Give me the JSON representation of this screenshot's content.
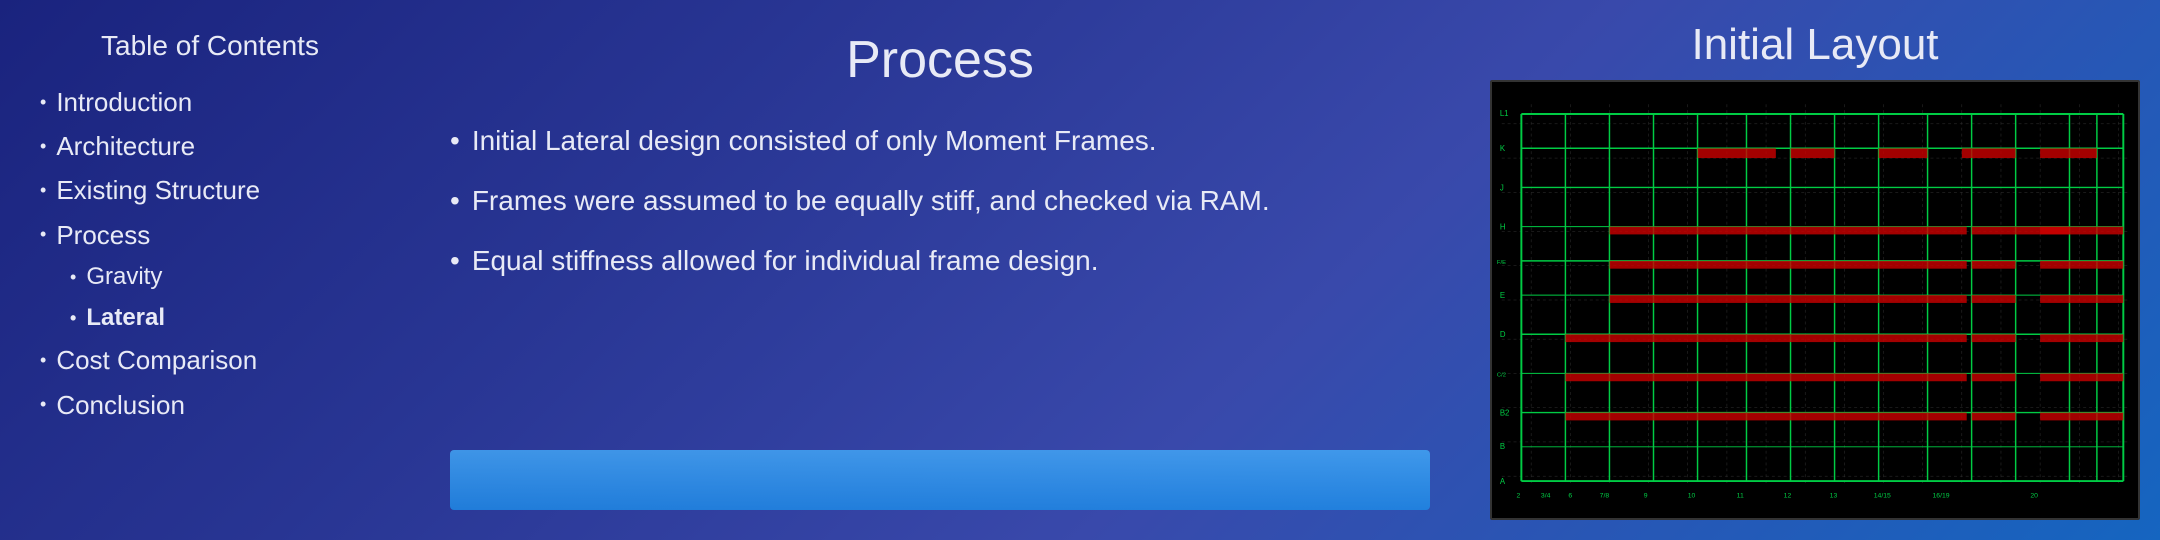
{
  "leftPanel": {
    "tocTitle": "Table of Contents",
    "items": [
      {
        "label": "Introduction",
        "level": "main"
      },
      {
        "label": "Architecture",
        "level": "main"
      },
      {
        "label": "Existing Structure",
        "level": "main"
      },
      {
        "label": "Process",
        "level": "main"
      },
      {
        "label": "Gravity",
        "level": "sub"
      },
      {
        "label": "Lateral",
        "level": "sub-bold"
      },
      {
        "label": "Cost Comparison",
        "level": "main"
      },
      {
        "label": "Conclusion",
        "level": "main"
      }
    ]
  },
  "centerPanel": {
    "title": "Process",
    "bullets": [
      "Initial Lateral design consisted of only Moment Frames.",
      "Frames were assumed to be equally stiff, and checked via RAM.",
      "Equal stiffness allowed for individual frame design."
    ]
  },
  "rightPanel": {
    "title": "Initial Layout"
  }
}
